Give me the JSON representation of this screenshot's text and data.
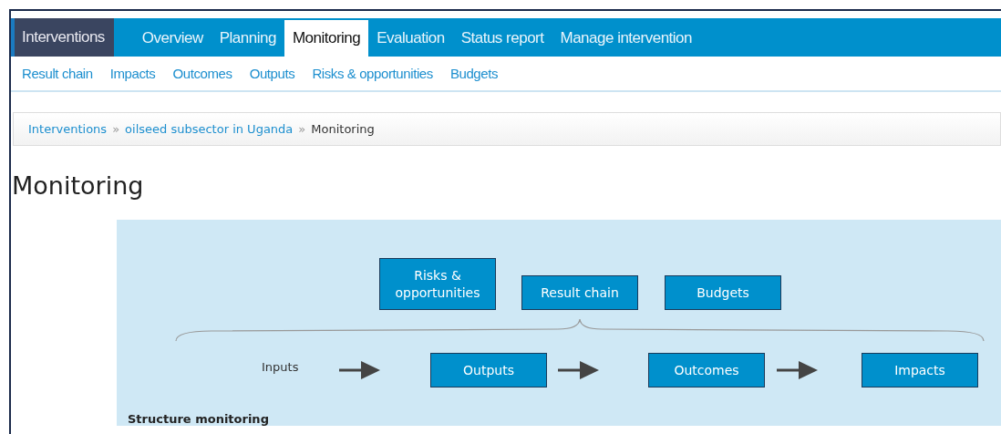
{
  "brand": "Interventions",
  "nav": [
    {
      "label": "Overview",
      "selected": false
    },
    {
      "label": "Planning",
      "selected": false
    },
    {
      "label": "Monitoring",
      "selected": true
    },
    {
      "label": "Evaluation",
      "selected": false
    },
    {
      "label": "Status report",
      "selected": false
    },
    {
      "label": "Manage intervention",
      "selected": false
    }
  ],
  "subnav": [
    "Result chain",
    "Impacts",
    "Outcomes",
    "Outputs",
    "Risks & opportunities",
    "Budgets"
  ],
  "breadcrumb": {
    "links": [
      "Interventions",
      "oilseed subsector in Uganda"
    ],
    "separator": "»",
    "current": "Monitoring"
  },
  "title": "Monitoring",
  "diagram": {
    "top_boxes": [
      "Risks & opportunities",
      "Result chain",
      "Budgets"
    ],
    "inputs_label": "Inputs",
    "chain_boxes": [
      "Outputs",
      "Outcomes",
      "Impacts"
    ]
  },
  "section_heading": "Structure monitoring"
}
